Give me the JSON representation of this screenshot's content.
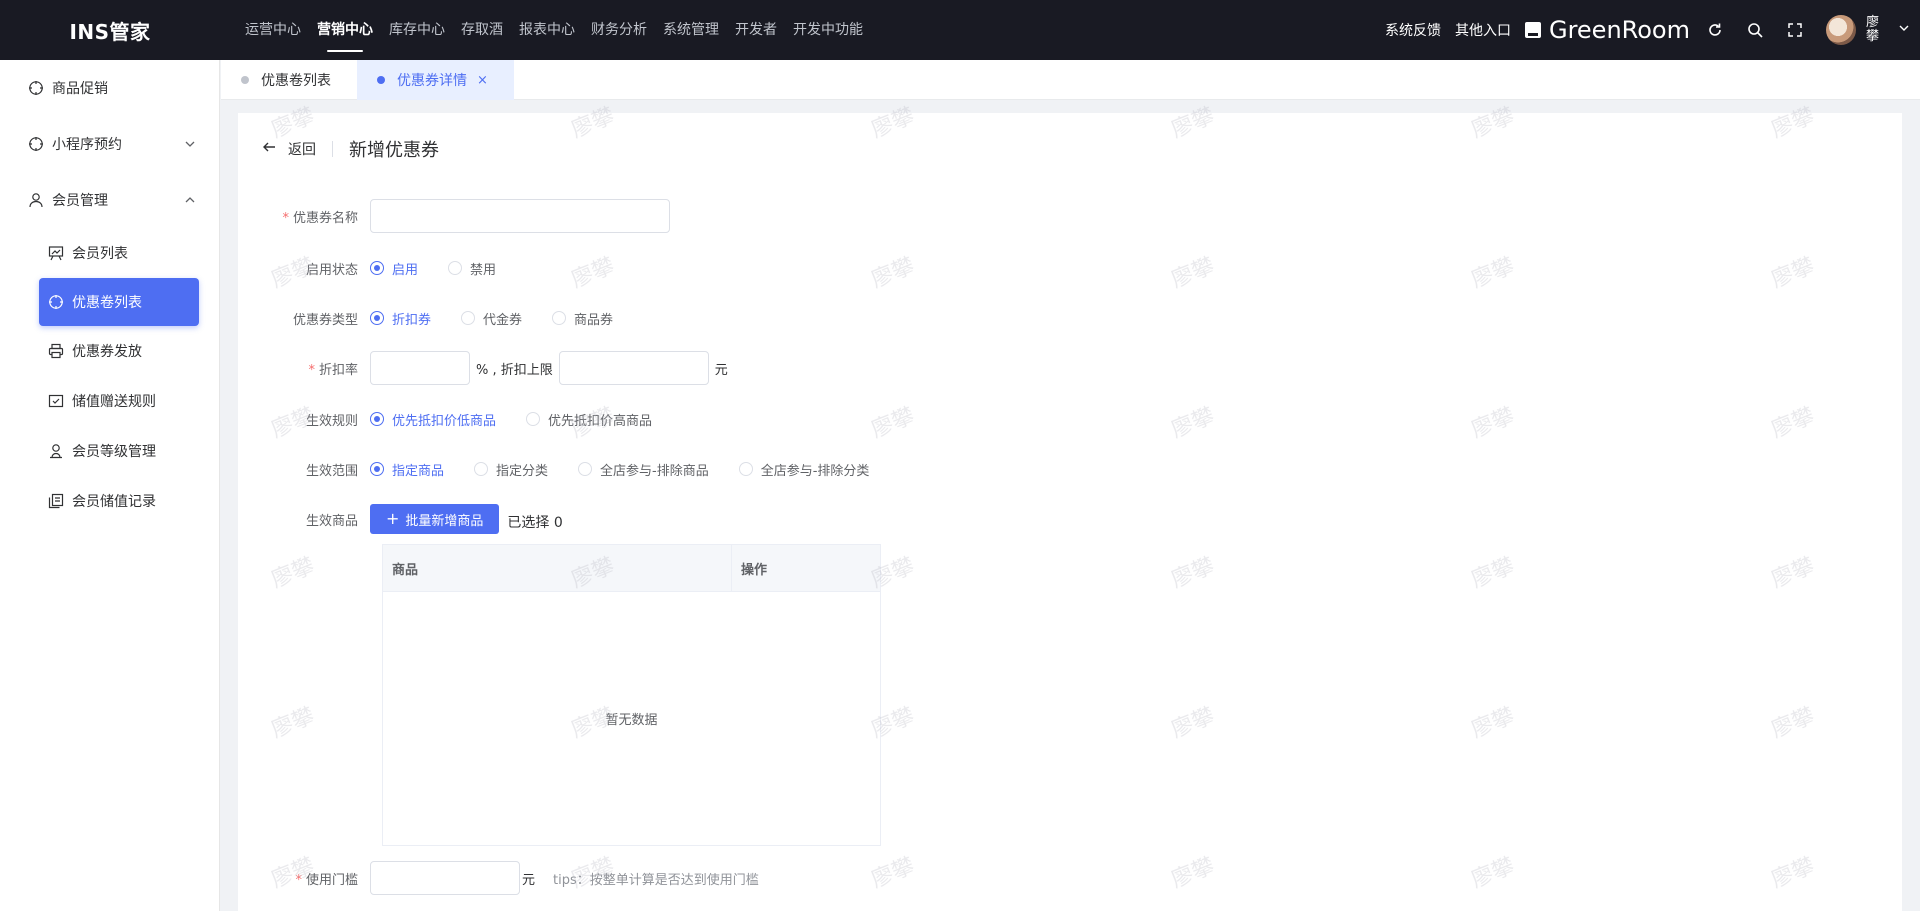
{
  "app": {
    "logo": "INS管家"
  },
  "topnav": {
    "items": [
      "运营中心",
      "营销中心",
      "库存中心",
      "存取酒",
      "报表中心",
      "财务分析",
      "系统管理",
      "开发者",
      "开发中功能"
    ],
    "active_index": 1
  },
  "topright": {
    "feedback": "系统反馈",
    "other_entry": "其他入口",
    "store_name": "GreenRoom",
    "user_name": "廖攀"
  },
  "sidebar": {
    "items": [
      {
        "label": "商品促销",
        "icon": "crosshair-icon"
      },
      {
        "label": "小程序预约",
        "icon": "crosshair-icon",
        "expanded": false
      },
      {
        "label": "会员管理",
        "icon": "user-icon",
        "expanded": true
      }
    ],
    "sub_items": [
      {
        "label": "会员列表",
        "icon": "chart-board-icon"
      },
      {
        "label": "优惠卷列表",
        "icon": "crosshair-icon",
        "active": true
      },
      {
        "label": "优惠券发放",
        "icon": "printer-icon"
      },
      {
        "label": "储值赠送规则",
        "icon": "inbox-check-icon"
      },
      {
        "label": "会员等级管理",
        "icon": "person-badge-icon"
      },
      {
        "label": "会员储值记录",
        "icon": "copy-doc-icon"
      }
    ]
  },
  "tabs": [
    {
      "label": "优惠卷列表",
      "active": false
    },
    {
      "label": "优惠券详情",
      "active": true,
      "close": "×"
    }
  ],
  "page": {
    "back": "返回",
    "title": "新增优惠券"
  },
  "form": {
    "name": {
      "label": "优惠券名称",
      "required": "*",
      "value": ""
    },
    "status": {
      "label": "启用状态",
      "options": [
        "启用",
        "禁用"
      ],
      "selected": 0
    },
    "type": {
      "label": "优惠券类型",
      "options": [
        "折扣券",
        "代金券",
        "商品券"
      ],
      "selected": 0
    },
    "discount": {
      "label": "折扣率",
      "required": "*",
      "rate_value": "",
      "unit_pct": "% , 折扣上限",
      "cap_value": "",
      "unit_yuan": "元"
    },
    "rule": {
      "label": "生效规则",
      "options": [
        "优先抵扣价低商品",
        "优先抵扣价高商品"
      ],
      "selected": 0
    },
    "scope": {
      "label": "生效范围",
      "options": [
        "指定商品",
        "指定分类",
        "全店参与-排除商品",
        "全店参与-排除分类"
      ],
      "selected": 0
    },
    "goods": {
      "label": "生效商品",
      "add_button": "批量新增商品",
      "plus": "+",
      "selected_text": "已选择 0",
      "columns": [
        "商品",
        "操作"
      ],
      "rows": [],
      "empty_text": "暂无数据"
    },
    "threshold": {
      "label": "使用门槛",
      "required": "*",
      "value": "",
      "unit": "元",
      "tips": "tips：按整单计算是否达到使用门槛"
    }
  },
  "watermark": "廖攀",
  "colors": {
    "primary": "#4e6ef2",
    "topbar": "#191a23",
    "required": "#f56c6c"
  }
}
